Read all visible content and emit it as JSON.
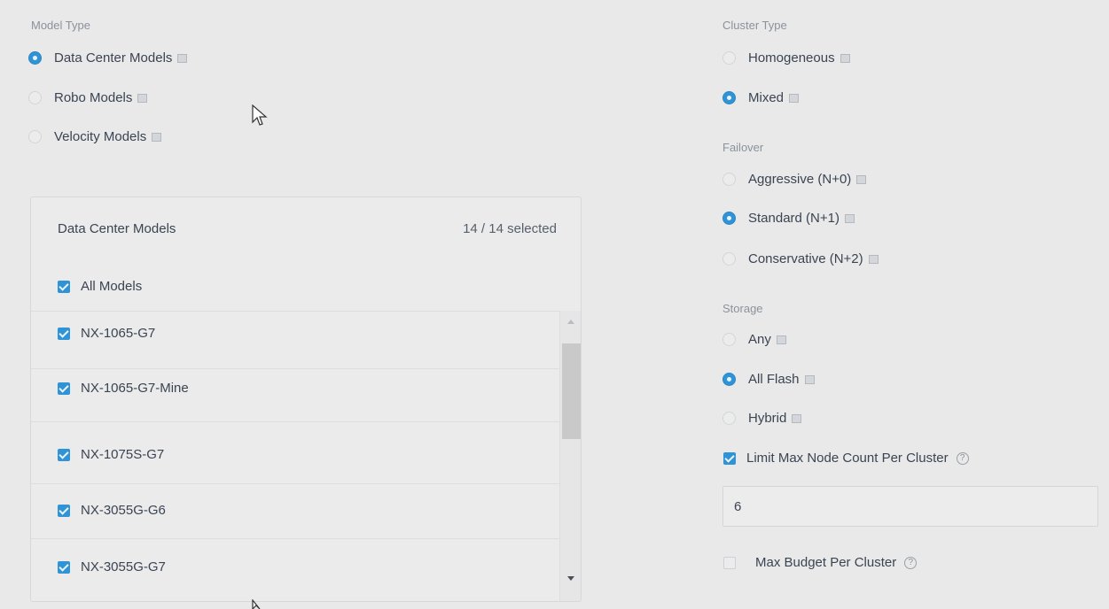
{
  "model_type": {
    "label": "Model Type",
    "options": [
      {
        "label": "Data Center Models",
        "selected": true
      },
      {
        "label": "Robo Models",
        "selected": false
      },
      {
        "label": "Velocity Models",
        "selected": false
      }
    ]
  },
  "models_panel": {
    "title": "Data Center Models",
    "count": "14 / 14 selected",
    "all_label": "All Models",
    "items": [
      "NX-1065-G7",
      "NX-1065-G7-Mine",
      "NX-1075S-G7",
      "NX-3055G-G6",
      "NX-3055G-G7"
    ]
  },
  "cluster_type": {
    "label": "Cluster Type",
    "options": [
      {
        "label": "Homogeneous",
        "selected": false
      },
      {
        "label": "Mixed",
        "selected": true
      }
    ]
  },
  "failover": {
    "label": "Failover",
    "options": [
      {
        "label": "Aggressive (N+0)",
        "selected": false
      },
      {
        "label": "Standard (N+1)",
        "selected": true
      },
      {
        "label": "Conservative (N+2)",
        "selected": false
      }
    ]
  },
  "storage": {
    "label": "Storage",
    "options": [
      {
        "label": "Any",
        "selected": false
      },
      {
        "label": "All Flash",
        "selected": true
      },
      {
        "label": "Hybrid",
        "selected": false
      }
    ]
  },
  "limit_node": {
    "label": "Limit Max Node Count Per Cluster",
    "checked": true,
    "value": "6"
  },
  "max_budget": {
    "label": "Max Budget Per Cluster",
    "checked": false
  },
  "colors": {
    "accent": "#2f93d6",
    "background": "#e9e9e9"
  }
}
